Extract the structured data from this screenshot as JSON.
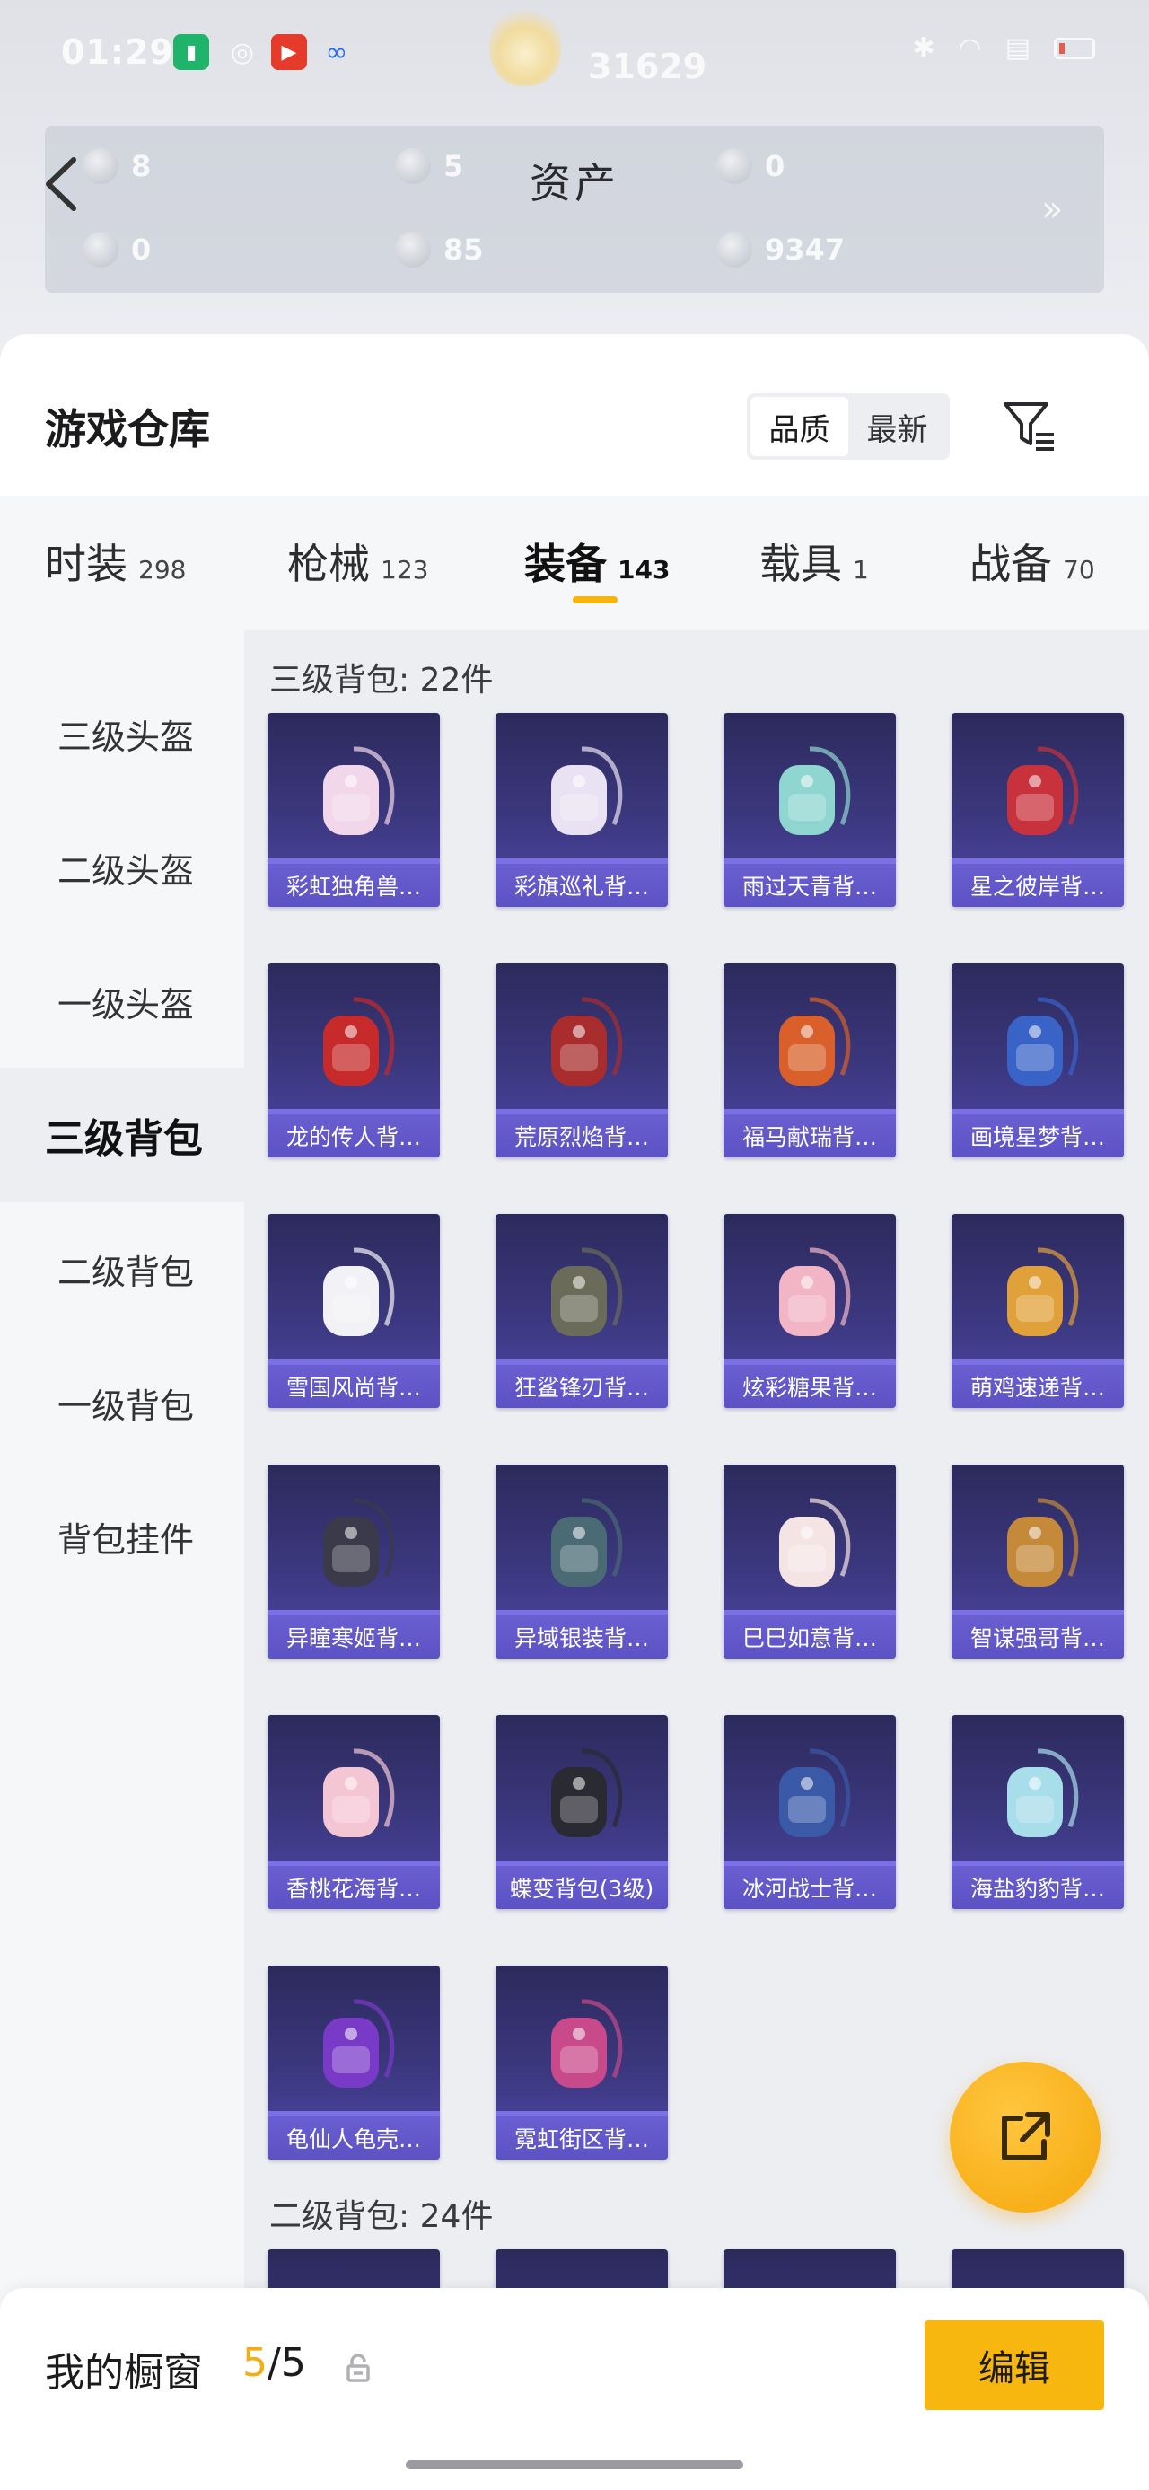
{
  "status_bar": {
    "time": "01:29",
    "icons": [
      "battery-app-icon",
      "circle-app-icon",
      "video-app-icon",
      "link-app-icon",
      "bluetooth-icon",
      "wifi-icon",
      "signal-icon",
      "battery-icon"
    ]
  },
  "header_overlay": {
    "score": "31629"
  },
  "assets": {
    "title": "资产",
    "items": [
      {
        "value": "8",
        "icon": "crystal-icon"
      },
      {
        "value": "5",
        "icon": "coin-icon"
      },
      {
        "value": "0",
        "icon": "badge-icon"
      },
      {
        "value": "0",
        "icon": "gem-icon"
      },
      {
        "value": "85",
        "icon": "silver-coin-icon"
      },
      {
        "value": "9347",
        "icon": "gold-coin-icon"
      }
    ],
    "more": "»"
  },
  "warehouse": {
    "title": "游戏仓库",
    "sort_options": [
      "品质",
      "最新"
    ],
    "active_sort": 0
  },
  "tabs": [
    {
      "label": "时装",
      "count": "298"
    },
    {
      "label": "枪械",
      "count": "123"
    },
    {
      "label": "装备",
      "count": "143"
    },
    {
      "label": "载具",
      "count": "1"
    },
    {
      "label": "战备",
      "count": "70"
    }
  ],
  "categories": [
    "三级头盔",
    "二级头盔",
    "一级头盔",
    "三级背包",
    "二级背包",
    "一级背包",
    "背包挂件"
  ],
  "active_category": 3,
  "sections": {
    "level3": {
      "title": "三级背包: 22件",
      "items": [
        {
          "name": "彩虹独角兽…",
          "color": "#f2d6ea"
        },
        {
          "name": "彩旗巡礼背…",
          "color": "#e9e2f2"
        },
        {
          "name": "雨过天青背…",
          "color": "#8ed6cf"
        },
        {
          "name": "星之彼岸背…",
          "color": "#c8323c"
        },
        {
          "name": "龙的传人背…",
          "color": "#c62a2a"
        },
        {
          "name": "荒原烈焰背…",
          "color": "#a92d2d"
        },
        {
          "name": "福马献瑞背…",
          "color": "#d9602a"
        },
        {
          "name": "画境星梦背…",
          "color": "#3a63c8"
        },
        {
          "name": "雪国风尚背…",
          "color": "#f2f2f6"
        },
        {
          "name": "狂鲨锋刃背…",
          "color": "#6b6b5a"
        },
        {
          "name": "炫彩糖果背…",
          "color": "#f2b5c6"
        },
        {
          "name": "萌鸡速递背…",
          "color": "#e0a03a"
        },
        {
          "name": "异瞳寒姬背…",
          "color": "#3a3a4a"
        },
        {
          "name": "异域银装背…",
          "color": "#4a6a74"
        },
        {
          "name": "巳巳如意背…",
          "color": "#f4e4e4"
        },
        {
          "name": "智谋强哥背…",
          "color": "#c48a3a"
        },
        {
          "name": "香桃花海背…",
          "color": "#f4c6d4"
        },
        {
          "name": "蝶变背包(3级)",
          "color": "#2a2a32"
        },
        {
          "name": "冰河战士背…",
          "color": "#3a5aa8"
        },
        {
          "name": "海盐豹豹背…",
          "color": "#a8ddea"
        },
        {
          "name": "龟仙人龟壳…",
          "color": "#7a3ac8"
        },
        {
          "name": "霓虹街区背…",
          "color": "#c84a8a"
        }
      ]
    },
    "level2": {
      "title": "二级背包: 24件"
    }
  },
  "showcase": {
    "label": "我的橱窗",
    "current": "5",
    "separator": "/",
    "total": "5",
    "edit_label": "编辑"
  },
  "colors": {
    "accent": "#f6b40f",
    "card_bg": "#3c3880",
    "card_label": "#5c52c4"
  }
}
